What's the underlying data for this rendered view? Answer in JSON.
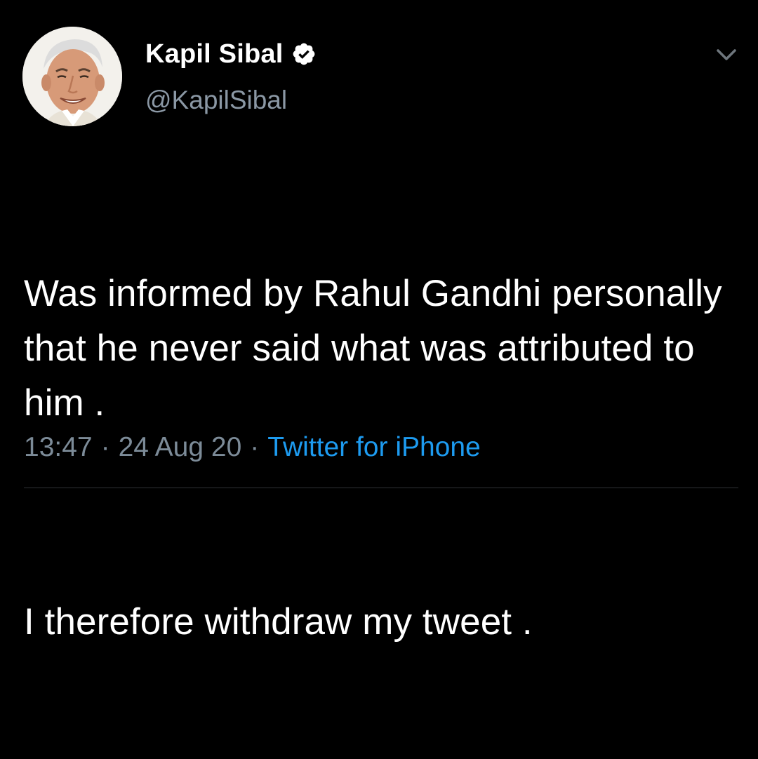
{
  "tweet": {
    "author": {
      "display_name": "Kapil Sibal",
      "handle": "@KapilSibal",
      "verified": true,
      "avatar_icon": "profile-photo"
    },
    "text": {
      "paragraph_1": "Was informed by Rahul Gandhi personally  that he never said what was attributed to him .",
      "paragraph_2": "I therefore withdraw my tweet ."
    },
    "meta": {
      "time": "13:47",
      "separator": "·",
      "date": "24 Aug 20",
      "source": "Twitter for iPhone"
    },
    "menu_icon": "chevron-down-icon"
  },
  "colors": {
    "background": "#000000",
    "name": "#ffffff",
    "handle": "#8b98a5",
    "text": "#ffffff",
    "meta": "#7c8b98",
    "link": "#1d9bf0",
    "verified_badge": "#ffffff",
    "divider": "#2f3336"
  }
}
